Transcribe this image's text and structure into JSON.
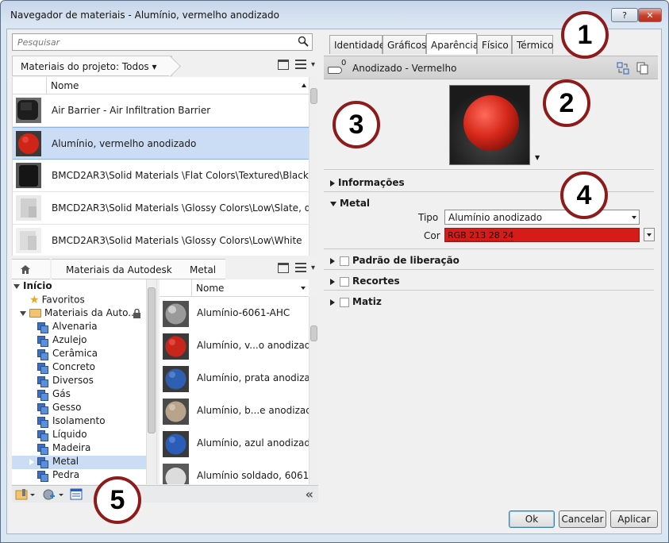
{
  "window": {
    "title": "Navegador de materiais - Alumínio, vermelho anodizado",
    "help_label": "?",
    "close_label": "✕"
  },
  "search": {
    "placeholder": "Pesquisar"
  },
  "project": {
    "filter_label": "Materiais do projeto: Todos",
    "column_header": "Nome",
    "rows": [
      {
        "name": "Air Barrier - Air Infiltration Barrier",
        "thumb": "dark-fabric"
      },
      {
        "name": "Alumínio, vermelho anodizado",
        "thumb": "red-sphere",
        "selected": true
      },
      {
        "name": "BMCD2AR3\\Solid Materials \\Flat Colors\\Textured\\Black",
        "thumb": "black-cube"
      },
      {
        "name": "BMCD2AR3\\Solid Materials \\Glossy Colors\\Low\\Slate, dark",
        "thumb": "white-cube"
      },
      {
        "name": "BMCD2AR3\\Solid Materials \\Glossy Colors\\Low\\White",
        "thumb": "white-cube"
      }
    ]
  },
  "library": {
    "breadcrumb": [
      "Materiais da Autodesk",
      "Metal"
    ],
    "tree": [
      {
        "label": "Início",
        "level": 0,
        "kind": "root"
      },
      {
        "label": "Favoritos",
        "level": 1,
        "kind": "star"
      },
      {
        "label": "Materiais da Auto...",
        "level": 1,
        "kind": "folder"
      },
      {
        "label": "Alvenaria",
        "level": 2,
        "kind": "lib"
      },
      {
        "label": "Azulejo",
        "level": 2,
        "kind": "lib"
      },
      {
        "label": "Cerâmica",
        "level": 2,
        "kind": "lib"
      },
      {
        "label": "Concreto",
        "level": 2,
        "kind": "lib"
      },
      {
        "label": "Diversos",
        "level": 2,
        "kind": "lib"
      },
      {
        "label": "Gás",
        "level": 2,
        "kind": "lib"
      },
      {
        "label": "Gesso",
        "level": 2,
        "kind": "lib"
      },
      {
        "label": "Isolamento",
        "level": 2,
        "kind": "lib"
      },
      {
        "label": "Líquido",
        "level": 2,
        "kind": "lib"
      },
      {
        "label": "Madeira",
        "level": 2,
        "kind": "lib"
      },
      {
        "label": "Metal",
        "level": 2,
        "kind": "lib",
        "selected": true
      },
      {
        "label": "Pedra",
        "level": 2,
        "kind": "lib"
      }
    ],
    "column_header": "Nome",
    "items": [
      {
        "name": "Alumínio-6061-AHC",
        "color": "#9a9a9a"
      },
      {
        "name": "Alumínio, v...o anodizado",
        "color": "#c9261b"
      },
      {
        "name": "Alumínio, prata anodizada",
        "color": "#2f5fb0"
      },
      {
        "name": "Alumínio, b...e anodizado",
        "color": "#b8a48a"
      },
      {
        "name": "Alumínio, azul anodizado",
        "color": "#2a5cb8"
      },
      {
        "name": "Alumínio soldado, 6061",
        "color": "#dcdcdc"
      }
    ]
  },
  "tabs": [
    "Identidade",
    "Gráficos",
    "Aparência",
    "Físico",
    "Térmico"
  ],
  "active_tab": "Aparência",
  "asset": {
    "count": "0",
    "name": "Anodizado - Vermelho"
  },
  "sections": {
    "info": "Informações",
    "metal": "Metal",
    "tipo_label": "Tipo",
    "tipo_value": "Alumínio anodizado",
    "cor_label": "Cor",
    "cor_value": "RGB 213 28 24",
    "pattern": "Padrão de liberação",
    "cutouts": "Recortes",
    "tint": "Matiz"
  },
  "buttons": {
    "ok": "Ok",
    "cancel": "Cancelar",
    "apply": "Aplicar"
  },
  "callouts": [
    "1",
    "2",
    "3",
    "4",
    "5"
  ],
  "colors": {
    "selection": "#cbddf4",
    "swatch": "#d51c18",
    "callout_border": "#8e1b1b"
  }
}
